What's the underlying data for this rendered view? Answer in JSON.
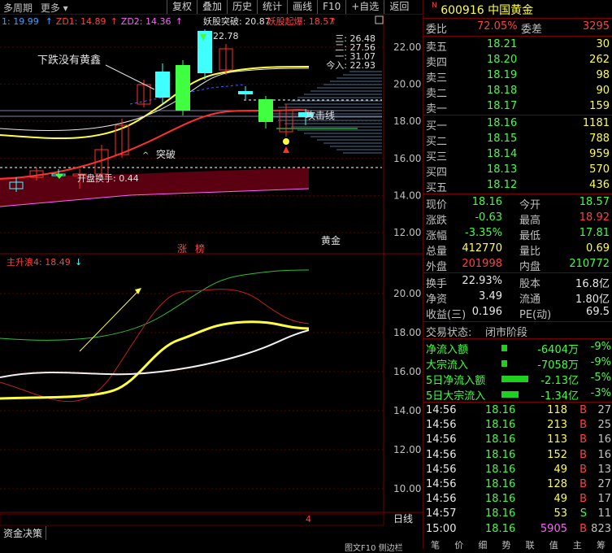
{
  "toolbar": {
    "period": "多周期",
    "more": "更多",
    "buttons": [
      "复权",
      "叠加",
      "历史",
      "统计",
      "画线",
      "F10",
      "+自选",
      "返回"
    ]
  },
  "main_chart": {
    "legend": [
      {
        "text": "1: 19.99",
        "color": "#40a0ff"
      },
      {
        "text": "ZD1: 14.89",
        "color": "#ff4040"
      },
      {
        "text": "ZD2: 14.36",
        "color": "#ff60ff"
      }
    ],
    "signals": [
      {
        "text": "妖股突破: 20.87",
        "color": "#e0e0e0"
      },
      {
        "text": "妖股起爆: 18.57",
        "color": "#ff4040"
      }
    ],
    "annotation_down": "下跌没有黄鑫",
    "annotation_break": "突破",
    "annotation_open": "开盘换手: 0.44",
    "annotation_line": "攻击线",
    "annotation_zhang": "涨",
    "annotation_bang": "榜",
    "stock_tag": "黄金",
    "peak_label": "22.78",
    "levels": [
      {
        "label": "三: 26.48"
      },
      {
        "label": "二: 27.56"
      },
      {
        "label": "一: 31.07"
      },
      {
        "label": "今入: 22.93"
      }
    ],
    "y_ticks": [
      "22.00",
      "20.00",
      "18.00",
      "16.00",
      "14.00",
      "12.00"
    ]
  },
  "sub_chart": {
    "legend": "主升浪4: 18.49",
    "y_ticks": [
      "20.00",
      "18.00",
      "16.00",
      "14.00",
      "12.00",
      "10.00"
    ],
    "marker": "4"
  },
  "bottom": {
    "tab_left": "资金决策",
    "day_line": "日线",
    "right_tabs": [
      "笔",
      "价",
      "细",
      "势",
      "联",
      "值",
      "主",
      "筹"
    ],
    "corner_tab": "图文F10",
    "side_tab": "侧边栏"
  },
  "quote": {
    "code": "600916",
    "name": "中国黄金",
    "badge": "N",
    "weibi_label": "委比",
    "weibi_value": "72.05%",
    "weicha_label": "委差",
    "weicha_value": "3295",
    "asks": [
      {
        "label": "卖五",
        "price": "18.21",
        "vol": "30"
      },
      {
        "label": "卖四",
        "price": "18.20",
        "vol": "262"
      },
      {
        "label": "卖三",
        "price": "18.19",
        "vol": "98"
      },
      {
        "label": "卖二",
        "price": "18.18",
        "vol": "90"
      },
      {
        "label": "卖一",
        "price": "18.17",
        "vol": "159"
      }
    ],
    "bids": [
      {
        "label": "买一",
        "price": "18.16",
        "vol": "1181"
      },
      {
        "label": "买二",
        "price": "18.15",
        "vol": "788"
      },
      {
        "label": "买三",
        "price": "18.14",
        "vol": "959"
      },
      {
        "label": "买四",
        "price": "18.13",
        "vol": "570"
      },
      {
        "label": "买五",
        "price": "18.12",
        "vol": "436"
      }
    ],
    "stats": [
      {
        "l1": "现价",
        "v1": "18.16",
        "c1": "green",
        "l2": "今开",
        "v2": "18.57",
        "c2": "green"
      },
      {
        "l1": "涨跌",
        "v1": "-0.63",
        "c1": "green",
        "l2": "最高",
        "v2": "18.92",
        "c2": "red"
      },
      {
        "l1": "涨幅",
        "v1": "-3.35%",
        "c1": "green",
        "l2": "最低",
        "v2": "17.81",
        "c2": "green"
      },
      {
        "l1": "总量",
        "v1": "412770",
        "c1": "yellow",
        "l2": "量比",
        "v2": "0.69",
        "c2": "yellow"
      },
      {
        "l1": "外盘",
        "v1": "201998",
        "c1": "red",
        "l2": "内盘",
        "v2": "210772",
        "c2": "green"
      }
    ],
    "stats2": [
      {
        "l1": "换手",
        "v1": "22.93%",
        "c1": "white",
        "l2": "股本",
        "v2": "16.8亿",
        "c2": "white"
      },
      {
        "l1": "净资",
        "v1": "3.49",
        "c1": "white",
        "l2": "流通",
        "v2": "1.80亿",
        "c2": "white"
      },
      {
        "l1": "收益(三)",
        "v1": "0.196",
        "c1": "white",
        "l2": "PE(动)",
        "v2": "69.5",
        "c2": "white"
      }
    ],
    "trade_status_label": "交易状态:",
    "trade_status": "闭市阶段",
    "flows": [
      {
        "label": "净流入额",
        "bar": 0.12,
        "value": "-6404万",
        "pct": "-9%"
      },
      {
        "label": "大宗流入",
        "bar": 0.12,
        "value": "-7058万",
        "pct": "-9%"
      },
      {
        "label": "5日净流入额",
        "bar": 0.55,
        "value": "-2.13亿",
        "pct": "-5%"
      },
      {
        "label": "5日大宗流入",
        "bar": 0.35,
        "value": "-1.34亿",
        "pct": "-3%"
      }
    ],
    "ticks": [
      {
        "time": "14:56",
        "price": "18.16",
        "vol": "118",
        "side": "B",
        "n": "27"
      },
      {
        "time": "14:56",
        "price": "18.16",
        "vol": "213",
        "side": "B",
        "n": "25"
      },
      {
        "time": "14:56",
        "price": "18.16",
        "vol": "113",
        "side": "B",
        "n": "16"
      },
      {
        "time": "14:56",
        "price": "18.16",
        "vol": "152",
        "side": "B",
        "n": "16"
      },
      {
        "time": "14:56",
        "price": "18.16",
        "vol": "49",
        "side": "B",
        "n": "13"
      },
      {
        "time": "14:56",
        "price": "18.16",
        "vol": "128",
        "side": "B",
        "n": "27"
      },
      {
        "time": "14:56",
        "price": "18.16",
        "vol": "49",
        "side": "B",
        "n": "17"
      },
      {
        "time": "14:57",
        "price": "18.16",
        "vol": "53",
        "side": "S",
        "n": "11"
      },
      {
        "time": "15:00",
        "price": "18.16",
        "vol": "5905",
        "side": "B",
        "n": "823"
      }
    ]
  },
  "colors": {
    "up": "#ff4040",
    "down": "#40ff40",
    "grid": "#7a0000",
    "bg": "#000000"
  }
}
